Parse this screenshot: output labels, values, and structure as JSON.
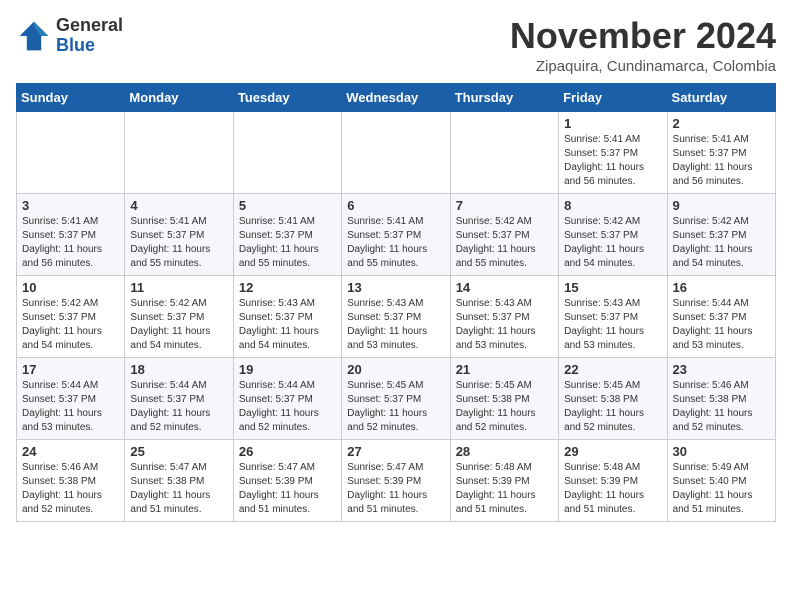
{
  "header": {
    "logo": {
      "general": "General",
      "blue": "Blue"
    },
    "month": "November 2024",
    "location": "Zipaquira, Cundinamarca, Colombia"
  },
  "weekdays": [
    "Sunday",
    "Monday",
    "Tuesday",
    "Wednesday",
    "Thursday",
    "Friday",
    "Saturday"
  ],
  "weeks": [
    [
      {
        "day": "",
        "info": ""
      },
      {
        "day": "",
        "info": ""
      },
      {
        "day": "",
        "info": ""
      },
      {
        "day": "",
        "info": ""
      },
      {
        "day": "",
        "info": ""
      },
      {
        "day": "1",
        "info": "Sunrise: 5:41 AM\nSunset: 5:37 PM\nDaylight: 11 hours and 56 minutes."
      },
      {
        "day": "2",
        "info": "Sunrise: 5:41 AM\nSunset: 5:37 PM\nDaylight: 11 hours and 56 minutes."
      }
    ],
    [
      {
        "day": "3",
        "info": "Sunrise: 5:41 AM\nSunset: 5:37 PM\nDaylight: 11 hours and 56 minutes."
      },
      {
        "day": "4",
        "info": "Sunrise: 5:41 AM\nSunset: 5:37 PM\nDaylight: 11 hours and 55 minutes."
      },
      {
        "day": "5",
        "info": "Sunrise: 5:41 AM\nSunset: 5:37 PM\nDaylight: 11 hours and 55 minutes."
      },
      {
        "day": "6",
        "info": "Sunrise: 5:41 AM\nSunset: 5:37 PM\nDaylight: 11 hours and 55 minutes."
      },
      {
        "day": "7",
        "info": "Sunrise: 5:42 AM\nSunset: 5:37 PM\nDaylight: 11 hours and 55 minutes."
      },
      {
        "day": "8",
        "info": "Sunrise: 5:42 AM\nSunset: 5:37 PM\nDaylight: 11 hours and 54 minutes."
      },
      {
        "day": "9",
        "info": "Sunrise: 5:42 AM\nSunset: 5:37 PM\nDaylight: 11 hours and 54 minutes."
      }
    ],
    [
      {
        "day": "10",
        "info": "Sunrise: 5:42 AM\nSunset: 5:37 PM\nDaylight: 11 hours and 54 minutes."
      },
      {
        "day": "11",
        "info": "Sunrise: 5:42 AM\nSunset: 5:37 PM\nDaylight: 11 hours and 54 minutes."
      },
      {
        "day": "12",
        "info": "Sunrise: 5:43 AM\nSunset: 5:37 PM\nDaylight: 11 hours and 54 minutes."
      },
      {
        "day": "13",
        "info": "Sunrise: 5:43 AM\nSunset: 5:37 PM\nDaylight: 11 hours and 53 minutes."
      },
      {
        "day": "14",
        "info": "Sunrise: 5:43 AM\nSunset: 5:37 PM\nDaylight: 11 hours and 53 minutes."
      },
      {
        "day": "15",
        "info": "Sunrise: 5:43 AM\nSunset: 5:37 PM\nDaylight: 11 hours and 53 minutes."
      },
      {
        "day": "16",
        "info": "Sunrise: 5:44 AM\nSunset: 5:37 PM\nDaylight: 11 hours and 53 minutes."
      }
    ],
    [
      {
        "day": "17",
        "info": "Sunrise: 5:44 AM\nSunset: 5:37 PM\nDaylight: 11 hours and 53 minutes."
      },
      {
        "day": "18",
        "info": "Sunrise: 5:44 AM\nSunset: 5:37 PM\nDaylight: 11 hours and 52 minutes."
      },
      {
        "day": "19",
        "info": "Sunrise: 5:44 AM\nSunset: 5:37 PM\nDaylight: 11 hours and 52 minutes."
      },
      {
        "day": "20",
        "info": "Sunrise: 5:45 AM\nSunset: 5:37 PM\nDaylight: 11 hours and 52 minutes."
      },
      {
        "day": "21",
        "info": "Sunrise: 5:45 AM\nSunset: 5:38 PM\nDaylight: 11 hours and 52 minutes."
      },
      {
        "day": "22",
        "info": "Sunrise: 5:45 AM\nSunset: 5:38 PM\nDaylight: 11 hours and 52 minutes."
      },
      {
        "day": "23",
        "info": "Sunrise: 5:46 AM\nSunset: 5:38 PM\nDaylight: 11 hours and 52 minutes."
      }
    ],
    [
      {
        "day": "24",
        "info": "Sunrise: 5:46 AM\nSunset: 5:38 PM\nDaylight: 11 hours and 52 minutes."
      },
      {
        "day": "25",
        "info": "Sunrise: 5:47 AM\nSunset: 5:38 PM\nDaylight: 11 hours and 51 minutes."
      },
      {
        "day": "26",
        "info": "Sunrise: 5:47 AM\nSunset: 5:39 PM\nDaylight: 11 hours and 51 minutes."
      },
      {
        "day": "27",
        "info": "Sunrise: 5:47 AM\nSunset: 5:39 PM\nDaylight: 11 hours and 51 minutes."
      },
      {
        "day": "28",
        "info": "Sunrise: 5:48 AM\nSunset: 5:39 PM\nDaylight: 11 hours and 51 minutes."
      },
      {
        "day": "29",
        "info": "Sunrise: 5:48 AM\nSunset: 5:39 PM\nDaylight: 11 hours and 51 minutes."
      },
      {
        "day": "30",
        "info": "Sunrise: 5:49 AM\nSunset: 5:40 PM\nDaylight: 11 hours and 51 minutes."
      }
    ]
  ]
}
